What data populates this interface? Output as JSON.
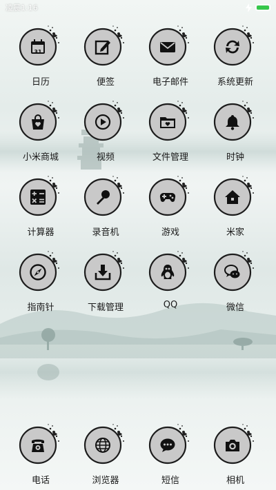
{
  "status_bar": {
    "time": "凌晨1:16",
    "battery_color": "#35c74a",
    "charging_icon": "bolt-icon"
  },
  "apps": [
    {
      "id": "calendar",
      "label": "日历",
      "icon": "calendar-icon",
      "icon_text": "31"
    },
    {
      "id": "notes",
      "label": "便签",
      "icon": "notepad-icon"
    },
    {
      "id": "email",
      "label": "电子邮件",
      "icon": "mail-icon"
    },
    {
      "id": "updater",
      "label": "系统更新",
      "icon": "update-icon"
    },
    {
      "id": "mistore",
      "label": "小米商城",
      "icon": "shopping-bag-icon"
    },
    {
      "id": "video",
      "label": "视频",
      "icon": "play-icon"
    },
    {
      "id": "files",
      "label": "文件管理",
      "icon": "folder-icon"
    },
    {
      "id": "clock",
      "label": "时钟",
      "icon": "bell-icon"
    },
    {
      "id": "calculator",
      "label": "计算器",
      "icon": "calculator-icon"
    },
    {
      "id": "recorder",
      "label": "录音机",
      "icon": "microphone-icon"
    },
    {
      "id": "games",
      "label": "游戏",
      "icon": "gamepad-icon"
    },
    {
      "id": "mihome",
      "label": "米家",
      "icon": "home-icon"
    },
    {
      "id": "compass",
      "label": "指南针",
      "icon": "compass-icon"
    },
    {
      "id": "downloads",
      "label": "下载管理",
      "icon": "download-icon"
    },
    {
      "id": "qq",
      "label": "QQ",
      "icon": "penguin-icon"
    },
    {
      "id": "wechat",
      "label": "微信",
      "icon": "chat-bubbles-icon"
    }
  ],
  "dock": [
    {
      "id": "phone",
      "label": "电话",
      "icon": "telephone-icon"
    },
    {
      "id": "browser",
      "label": "浏览器",
      "icon": "globe-icon"
    },
    {
      "id": "messages",
      "label": "短信",
      "icon": "message-icon"
    },
    {
      "id": "camera",
      "label": "相机",
      "icon": "camera-icon"
    }
  ],
  "theme": {
    "icon_face": "#c9c9c9",
    "icon_ring": "#1c1c1c",
    "glyph": "#111111"
  }
}
